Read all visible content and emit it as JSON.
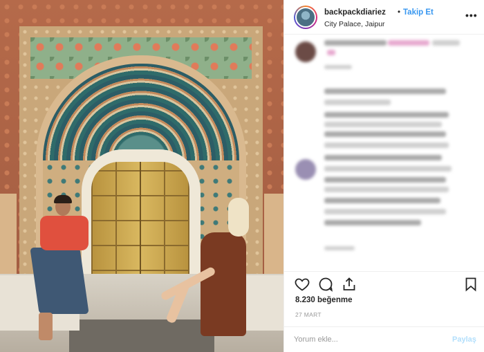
{
  "post": {
    "username": "backpackdiariez",
    "separator": "•",
    "follow_label": "Takip Et",
    "location": "City Palace, Jaipur",
    "more_icon": "more-horizontal-icon"
  },
  "photo": {
    "subject": "couple posing in front of Peacock Gate, City Palace Jaipur"
  },
  "actions": {
    "like_icon": "heart-icon",
    "comment_icon": "comment-icon",
    "share_icon": "share-icon",
    "save_icon": "bookmark-icon"
  },
  "stats": {
    "likes": "8.230 beğenme",
    "date": "27 MART"
  },
  "comment_form": {
    "placeholder": "Yorum ekle...",
    "post_label": "Paylaş"
  },
  "colors": {
    "accent_blue": "#3897f0",
    "disabled_blue": "#b2dffc",
    "text": "#262626",
    "muted": "#999999"
  }
}
